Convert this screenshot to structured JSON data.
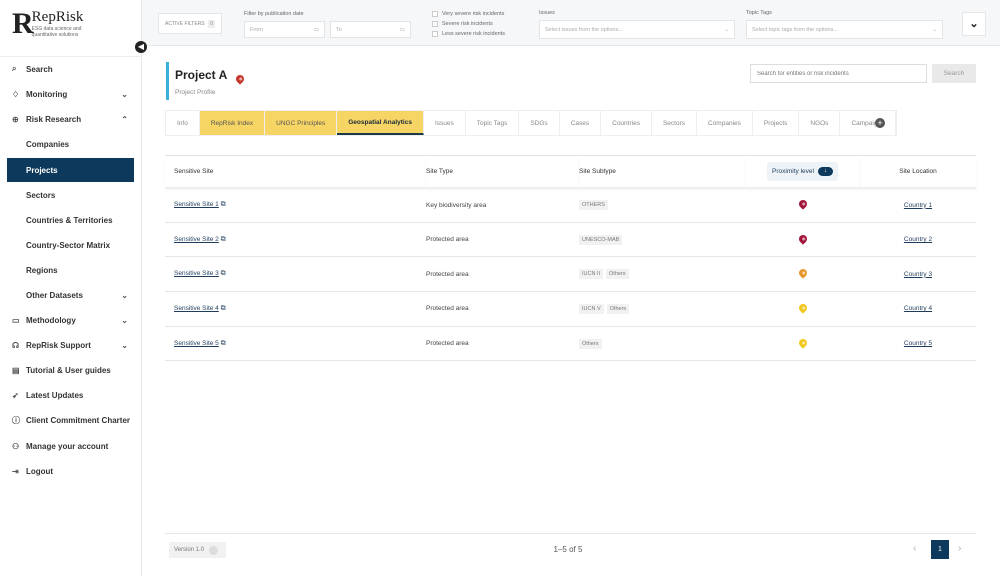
{
  "brand": {
    "name": "RepRisk",
    "tagline": "ESG data science and quantitative solutions",
    "mark": "R"
  },
  "sidebar": {
    "items": [
      {
        "label": "Search",
        "icon": "search-icon",
        "glyph": "⌕"
      },
      {
        "label": "Monitoring",
        "icon": "bell-icon",
        "glyph": "♢",
        "chevron": "⌄"
      },
      {
        "label": "Risk Research",
        "icon": "globe-icon",
        "glyph": "⊕",
        "chevron": "⌃"
      },
      {
        "label": "Companies",
        "sub": true
      },
      {
        "label": "Projects",
        "sub": true,
        "active": true
      },
      {
        "label": "Sectors",
        "sub": true
      },
      {
        "label": "Countries & Territories",
        "sub": true
      },
      {
        "label": "Country-Sector Matrix",
        "sub": true
      },
      {
        "label": "Regions",
        "sub": true
      },
      {
        "label": "Other Datasets",
        "sub": true,
        "chevron": "⌄"
      },
      {
        "label": "Methodology",
        "icon": "book-icon",
        "glyph": "▭",
        "chevron": "⌄"
      },
      {
        "label": "RepRisk Support",
        "icon": "headset-icon",
        "glyph": "☊",
        "chevron": "⌄"
      },
      {
        "label": "Tutorial & User guides",
        "icon": "document-icon",
        "glyph": "▤"
      },
      {
        "label": "Latest Updates",
        "icon": "rocket-icon",
        "glyph": "➶"
      },
      {
        "label": "Client Commitment Charter",
        "icon": "info-icon",
        "glyph": "ⓘ"
      },
      {
        "label": "Manage your account",
        "icon": "users-icon",
        "glyph": "⚇"
      },
      {
        "label": "Logout",
        "icon": "logout-icon",
        "glyph": "⇥"
      }
    ]
  },
  "filters": {
    "active_label": "ACTIVE FILTERS",
    "active_count": "0",
    "date_label": "Filter by publication date",
    "from_placeholder": "From",
    "to_placeholder": "To",
    "severity": [
      "Very severe risk incidents",
      "Severe risk incidents",
      "Less severe risk incidents"
    ],
    "issues_label": "Issues",
    "issues_placeholder": "Select issues from the options...",
    "tags_label": "Topic Tags",
    "tags_placeholder": "Select topic tags from the options..."
  },
  "header": {
    "title": "Project A",
    "subtitle": "Project Profile",
    "search_placeholder": "Search for entities or risk incidents",
    "search_button": "Search"
  },
  "tabs": [
    {
      "label": "Info"
    },
    {
      "label": "RepRisk Index",
      "y": true
    },
    {
      "label": "UNGC Principles",
      "y": true
    },
    {
      "label": "Geospatial Analytics",
      "selected": true
    },
    {
      "label": "Issues"
    },
    {
      "label": "Topic Tags"
    },
    {
      "label": "SDGs"
    },
    {
      "label": "Cases"
    },
    {
      "label": "Countries"
    },
    {
      "label": "Sectors"
    },
    {
      "label": "Companies"
    },
    {
      "label": "Projects"
    },
    {
      "label": "NGOs"
    },
    {
      "label": "Campaigns"
    }
  ],
  "table": {
    "columns": [
      "Sensitive Site",
      "Site Type",
      "Site Subtype",
      "Proximity level",
      "Site Location"
    ],
    "rows": [
      {
        "site": "Sensitive Site 1",
        "type": "Key biodiversity area",
        "subtypes": [
          "OTHERS"
        ],
        "proximity_color": "#a3163a",
        "location": "Country 1"
      },
      {
        "site": "Sensitive Site 2",
        "type": "Protected area",
        "subtypes": [
          "UNESCO-MAB"
        ],
        "proximity_color": "#a3163a",
        "location": "Country 2"
      },
      {
        "site": "Sensitive Site 3",
        "type": "Protected area",
        "subtypes": [
          "IUCN II",
          "Others"
        ],
        "proximity_color": "#e8962e",
        "location": "Country 3"
      },
      {
        "site": "Sensitive Site 4",
        "type": "Protected area",
        "subtypes": [
          "IUCN V",
          "Others"
        ],
        "proximity_color": "#f2c81e",
        "location": "Country 4"
      },
      {
        "site": "Sensitive Site 5",
        "type": "Protected area",
        "subtypes": [
          "Others"
        ],
        "proximity_color": "#f2c81e",
        "location": "Country 5"
      }
    ]
  },
  "footer": {
    "version": "Version 1.0",
    "range": "1–5 of 5",
    "page": "1"
  }
}
